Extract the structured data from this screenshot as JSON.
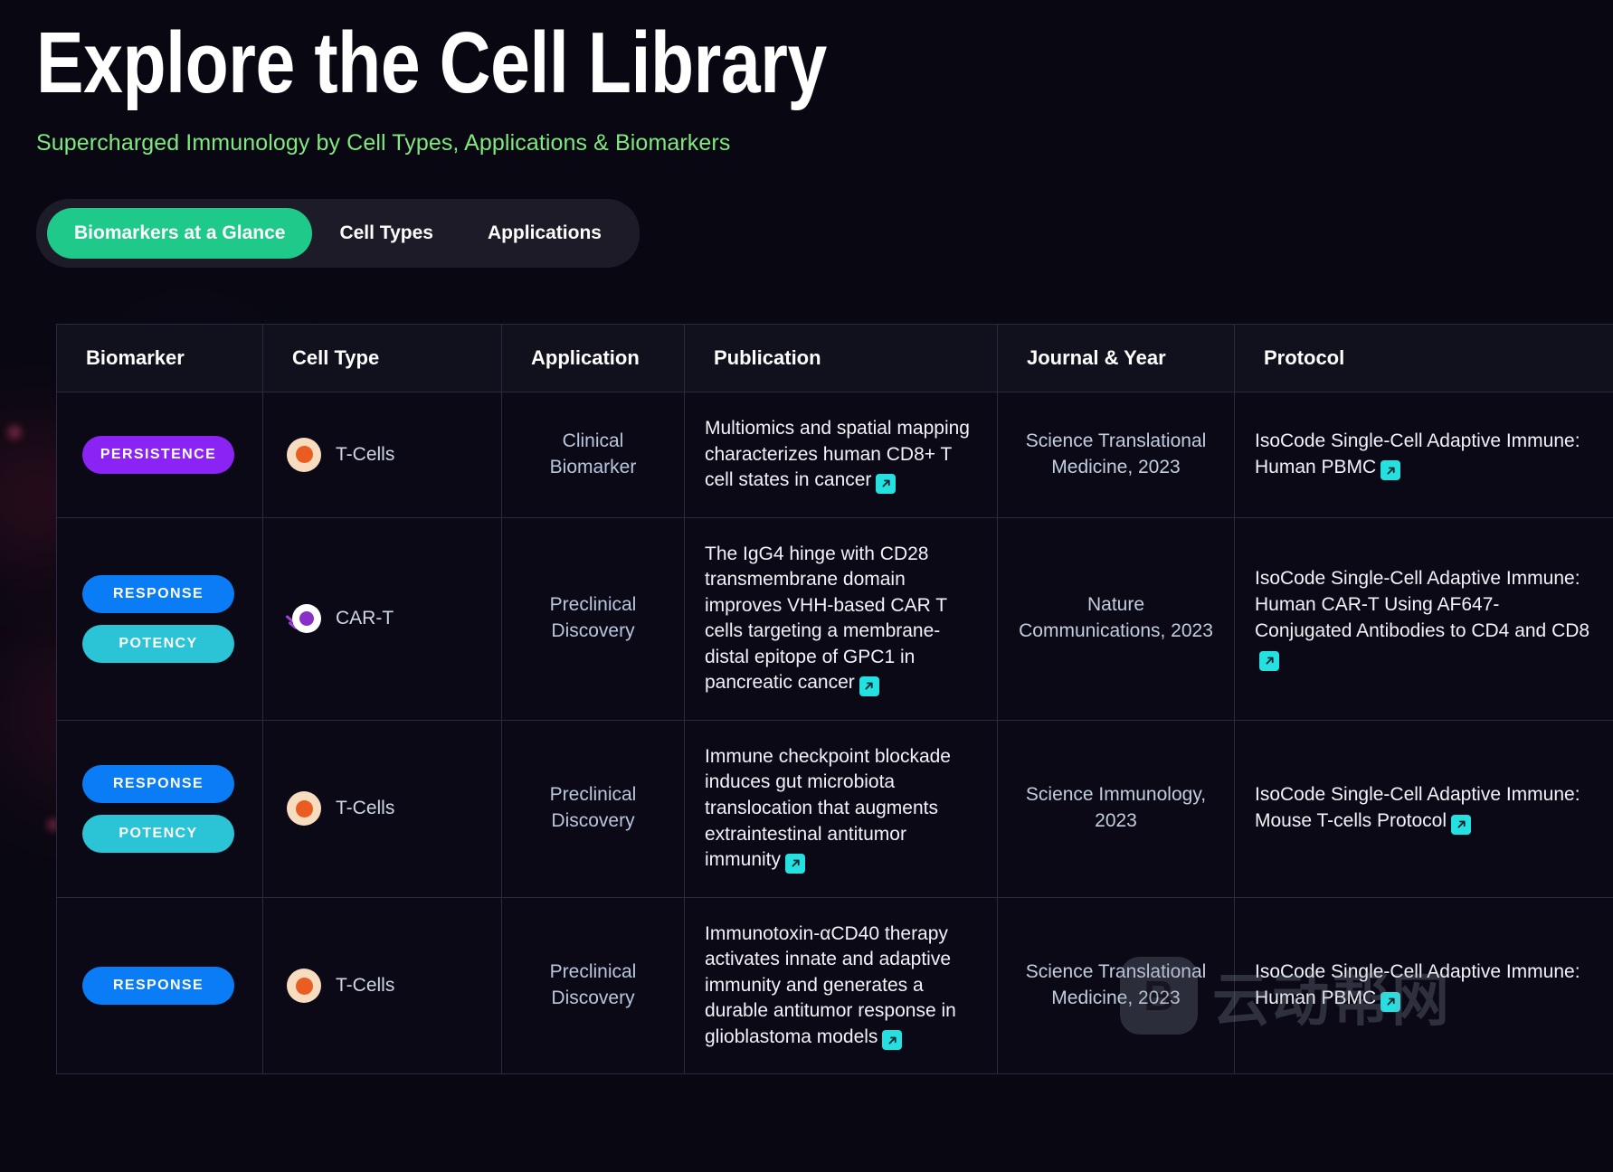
{
  "header": {
    "title": "Explore the Cell Library",
    "subtitle": "Supercharged Immunology by Cell Types, Applications & Biomarkers"
  },
  "tabs": [
    {
      "label": "Biomarkers at a Glance",
      "active": true
    },
    {
      "label": "Cell Types",
      "active": false
    },
    {
      "label": "Applications",
      "active": false
    }
  ],
  "table": {
    "columns": [
      "Biomarker",
      "Cell Type",
      "Application",
      "Publication",
      "Journal & Year",
      "Protocol"
    ],
    "rows": [
      {
        "biomarkers": [
          {
            "label": "PERSISTENCE",
            "color": "#8b23f5"
          }
        ],
        "cell_type": "T-Cells",
        "cell_icon": "t-cell-icon",
        "application": "Clinical Biomarker",
        "publication": "Multiomics and spatial mapping characterizes human CD8+ T cell states in cancer",
        "journal": "Science Translational Medicine, 2023",
        "protocol": "IsoCode Single-Cell Adaptive Immune: Human PBMC"
      },
      {
        "biomarkers": [
          {
            "label": "RESPONSE",
            "color": "#0a7cf5"
          },
          {
            "label": "POTENCY",
            "color": "#2bc4d6"
          }
        ],
        "cell_type": "CAR-T",
        "cell_icon": "car-t-icon",
        "application": "Preclinical Discovery",
        "publication": "The IgG4 hinge with CD28 transmembrane domain improves VHH-based CAR T cells targeting a membrane-distal epitope of GPC1 in pancreatic cancer",
        "journal": "Nature Communications, 2023",
        "protocol": "IsoCode Single-Cell Adaptive Immune: Human CAR-T Using AF647-Conjugated Antibodies to CD4 and CD8"
      },
      {
        "biomarkers": [
          {
            "label": "RESPONSE",
            "color": "#0a7cf5"
          },
          {
            "label": "POTENCY",
            "color": "#2bc4d6"
          }
        ],
        "cell_type": "T-Cells",
        "cell_icon": "t-cell-icon",
        "application": "Preclinical Discovery",
        "publication": "Immune checkpoint blockade induces gut microbiota translocation that augments extraintestinal antitumor immunity",
        "journal": "Science Immunology, 2023",
        "protocol": "IsoCode Single-Cell Adaptive Immune: Mouse T-cells Protocol"
      },
      {
        "biomarkers": [
          {
            "label": "RESPONSE",
            "color": "#0a7cf5"
          }
        ],
        "cell_type": "T-Cells",
        "cell_icon": "t-cell-icon",
        "application": "Preclinical Discovery",
        "publication": "Immunotoxin-αCD40 therapy activates innate and adaptive immunity and generates a durable antitumor response in glioblastoma models",
        "journal": "Science Translational Medicine, 2023",
        "protocol": "IsoCode Single-Cell Adaptive Immune: Human PBMC"
      }
    ]
  },
  "watermark": {
    "logo": "B",
    "text": "云动帮网"
  },
  "colors": {
    "accent_green": "#1fc98a",
    "subtitle_green": "#7fe87f",
    "link_cyan": "#25e0e0",
    "page_bg": "#090812"
  }
}
